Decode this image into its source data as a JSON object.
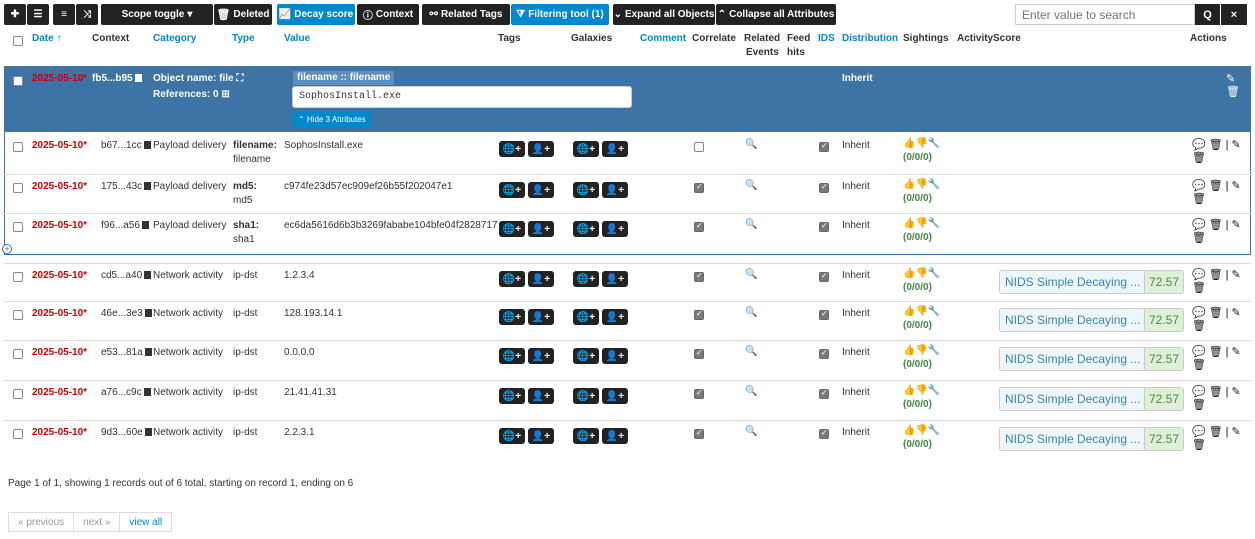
{
  "toolbar": {
    "add_icon": "plus-icon",
    "list_icon": "list-icon",
    "scope_toggle": "Scope toggle",
    "deleted": "Deleted",
    "decay_score": "Decay score",
    "context": "Context",
    "related_tags": "Related Tags",
    "filtering_tool": "Filtering tool (1)",
    "expand_all": "Expand all Objects",
    "collapse_all": "Collapse all Attributes",
    "search_placeholder": "Enter value to search",
    "search_icon": "Q",
    "clear_icon": "×"
  },
  "headers": {
    "date": "Date ↑",
    "context": "Context",
    "category": "Category",
    "type": "Type",
    "value": "Value",
    "tags": "Tags",
    "galaxies": "Galaxies",
    "comment": "Comment",
    "correlate": "Correlate",
    "related_1": "Related",
    "related_2": "Events",
    "feed_1": "Feed",
    "feed_2": "hits",
    "ids": "IDS",
    "distribution": "Distribution",
    "sightings": "Sightings",
    "activity": "Activity",
    "score": "Score",
    "actions": "Actions"
  },
  "object": {
    "date": "2025-05-10*",
    "uuid": "fb5...b95",
    "name_label": "Object name: file",
    "references_label": "References: 0",
    "attr_header": "filename :: filename",
    "attr_value": "SophosInstall.exe",
    "hide_attrs": "Hide 3 Attributes",
    "distribution": "Inherit"
  },
  "object_rows": [
    {
      "date": "2025-05-10*",
      "uuid": "b67...1cc",
      "category": "Payload delivery",
      "type": "filename:",
      "type_sub": "filename",
      "value": "SophosInstall.exe",
      "ids": true,
      "correlate": false,
      "distribution": "Inherit",
      "sightings": "(0/0/0)"
    },
    {
      "date": "2025-05-10*",
      "uuid": "175...43c",
      "category": "Payload delivery",
      "type": "md5:",
      "type_sub": "md5",
      "value": "c974fe23d57ec909ef26b55f202047e1",
      "ids": true,
      "correlate": true,
      "distribution": "Inherit",
      "sightings": "(0/0/0)"
    },
    {
      "date": "2025-05-10*",
      "uuid": "f96...a56",
      "category": "Payload delivery",
      "type": "sha1:",
      "type_sub": "sha1",
      "value": "ec6da5616d6b3b3269fababe104bfe04f2828717",
      "ids": true,
      "correlate": true,
      "distribution": "Inherit",
      "sightings": "(0/0/0)"
    }
  ],
  "rows": [
    {
      "date": "2025-05-10*",
      "uuid": "cd5...a40",
      "category": "Network activity",
      "type": "ip-dst",
      "value": "1.2.3.4",
      "distribution": "Inherit",
      "sightings": "(0/0/0)",
      "score_name": "NIDS Simple Decaying ...",
      "score": "72.57"
    },
    {
      "date": "2025-05-10*",
      "uuid": "46e...3e3",
      "category": "Network activity",
      "type": "ip-dst",
      "value": "128.193.14.1",
      "distribution": "Inherit",
      "sightings": "(0/0/0)",
      "score_name": "NIDS Simple Decaying ...",
      "score": "72.57"
    },
    {
      "date": "2025-05-10*",
      "uuid": "e53...81a",
      "category": "Network activity",
      "type": "ip-dst",
      "value": "0.0.0.0",
      "distribution": "Inherit",
      "sightings": "(0/0/0)",
      "score_name": "NIDS Simple Decaying ...",
      "score": "72.57"
    },
    {
      "date": "2025-05-10*",
      "uuid": "a76...c9c",
      "category": "Network activity",
      "type": "ip-dst",
      "value": "21.41.41.31",
      "distribution": "Inherit",
      "sightings": "(0/0/0)",
      "score_name": "NIDS Simple Decaying ...",
      "score": "72.57"
    },
    {
      "date": "2025-05-10*",
      "uuid": "9d3...60e",
      "category": "Network activity",
      "type": "ip-dst",
      "value": "2.2.3.1",
      "distribution": "Inherit",
      "sightings": "(0/0/0)",
      "score_name": "NIDS Simple Decaying ...",
      "score": "72.57"
    }
  ],
  "footer": {
    "summary": "Page 1 of 1, showing 1 records out of 6 total, starting on record 1, ending on 6",
    "prev": "« previous",
    "next": "next »",
    "view_all": "view all"
  }
}
